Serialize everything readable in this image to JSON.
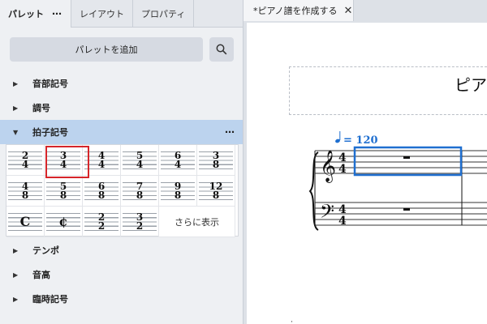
{
  "left_panel": {
    "tabs": [
      {
        "label": "パレット",
        "menu": "⋯"
      },
      {
        "label": "レイアウト"
      },
      {
        "label": "プロパティ"
      }
    ],
    "add_palette_label": "パレットを追加",
    "sections": {
      "clef": "音部記号",
      "key": "調号",
      "time": "拍子記号",
      "tempo": "テンポ",
      "pitch": "音高",
      "accidentals": "臨時記号"
    },
    "time_signatures": [
      [
        "2",
        "4"
      ],
      [
        "3",
        "4"
      ],
      [
        "4",
        "4"
      ],
      [
        "5",
        "4"
      ],
      [
        "6",
        "4"
      ],
      [
        "3",
        "8"
      ],
      [
        "4",
        "8"
      ],
      [
        "5",
        "8"
      ],
      [
        "6",
        "8"
      ],
      [
        "7",
        "8"
      ],
      [
        "9",
        "8"
      ],
      [
        "12",
        "8"
      ],
      [
        "C",
        ""
      ],
      [
        "¢",
        ""
      ],
      [
        "2",
        "2"
      ],
      [
        "3",
        "2"
      ]
    ],
    "show_more_label": "さらに表示",
    "selected_cell": "3/4",
    "section_menu": "⋯"
  },
  "document": {
    "tab_title": "*ピアノ譜を作成する",
    "tab_close": "✕",
    "title_text": "ピア",
    "tempo_value": "= 120",
    "time_signature": [
      "4",
      "4"
    ]
  },
  "icons": {
    "search": "search-icon",
    "collapsed": "▶",
    "expanded": "▼"
  },
  "colors": {
    "selection_blue": "#1f6fd0",
    "highlight_red": "#d6252a",
    "section_open_bg": "#bcd3ee"
  }
}
